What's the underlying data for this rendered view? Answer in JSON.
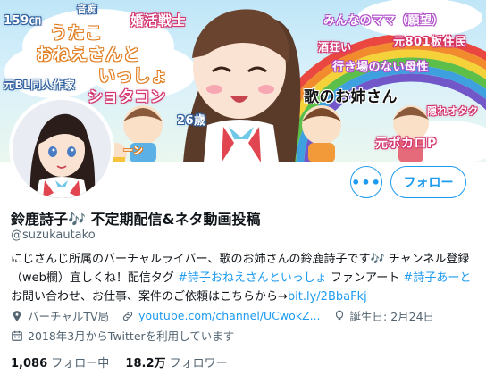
{
  "banner": {
    "tags": {
      "height": "159㎝",
      "music": "音痴",
      "konkatsu": "婚活戦士",
      "mama": "みんなのママ（願望）",
      "board": "元801板住民",
      "sakekurui": "酒狂い",
      "title1": "うたこ",
      "title2": "おねえさんと",
      "title3": "いっしょ",
      "bl": "元BL同人作家",
      "shotacon": "ショタコン",
      "ikiba": "行き場のない母性",
      "onesan": "歌のお姉さん",
      "age": "26歳",
      "otaku": "隠れオタク",
      "porn": "元ポカロP",
      "chaos": "ーン"
    }
  },
  "buttons": {
    "more_label": "•••",
    "follow_label": "フォロー"
  },
  "profile": {
    "name": "鈴鹿詩子",
    "name_emoji": "🎶",
    "name_suffix": " 不定期配信&ネタ動画投稿",
    "handle": "@suzukautako",
    "bio_part1": "にじさんじ所属のバーチャルライバー、歌のお姉さんの鈴鹿詩子です",
    "bio_emoji": "🎶",
    "bio_part2": " チャンネル登録（web欄）宜しくね！配信タグ ",
    "bio_tag1": "#詩子おねえさんといっしょ",
    "bio_part3": " ファンアート ",
    "bio_tag2": "#詩子あーと",
    "bio_part4": " お問い合わせ、お仕事、案件のご依頼はこちらから→",
    "bio_link": "bit.ly/2BbaFkj",
    "location": "バーチャルTV局",
    "website": "youtube.com/channel/UCwokZ...",
    "birthday": "誕生日: 2月24日",
    "joined": "2018年3月からTwitterを利用しています",
    "following_count": "1,086",
    "following_label": "フォロー中",
    "followers_count": "18.2万",
    "followers_label": "フォロワー"
  },
  "colors": {
    "accent": "#1d9bf0",
    "muted": "#536471",
    "text": "#0f1419"
  }
}
